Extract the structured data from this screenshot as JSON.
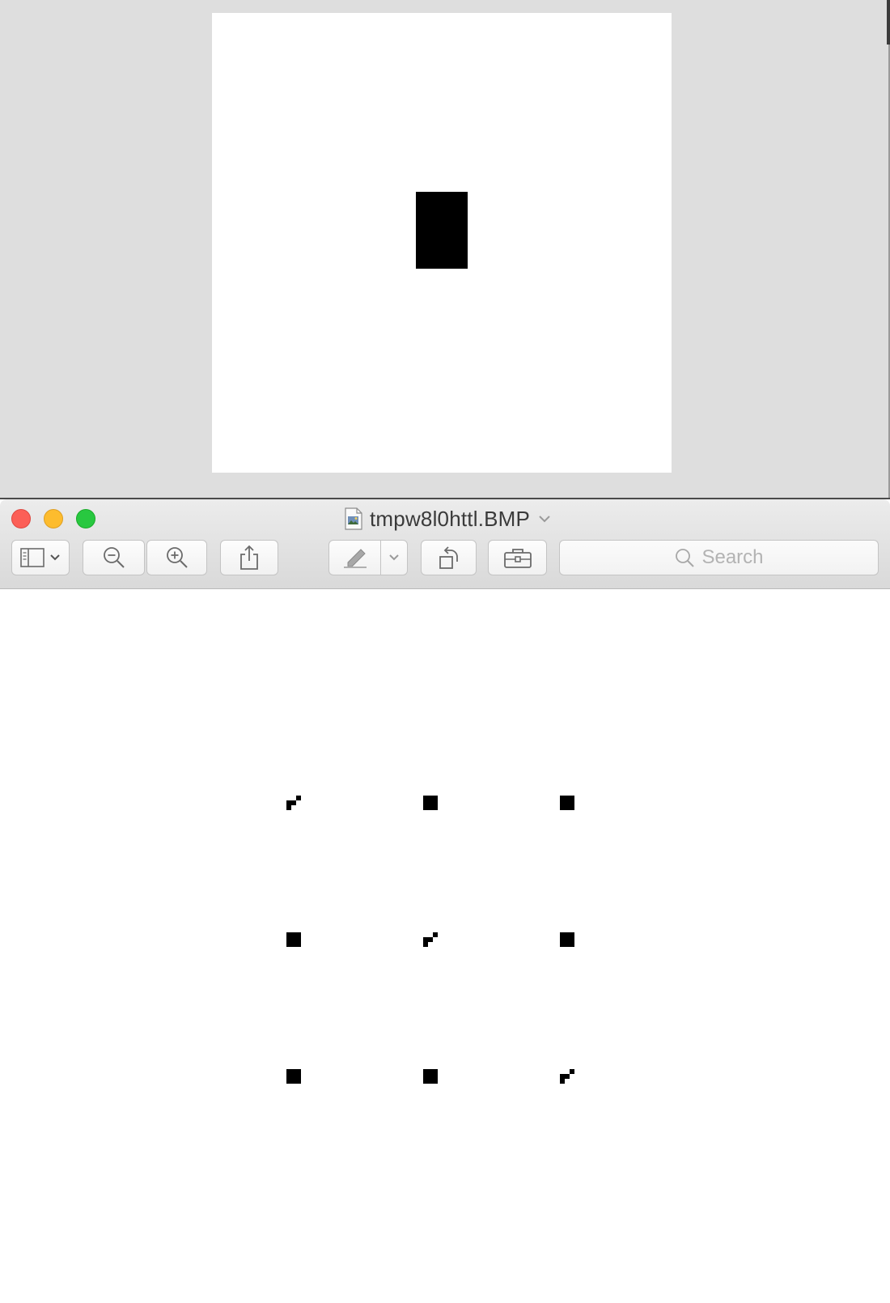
{
  "window": {
    "title": "tmpw8l0httl.BMP",
    "document_icon": "image-document-icon",
    "title_menu_icon": "chevron-down-icon"
  },
  "toolbar": {
    "sidebar_button_icon": "sidebar-icon",
    "sidebar_menu_icon": "chevron-down-icon",
    "zoom_out_icon": "zoom-out-icon",
    "zoom_in_icon": "zoom-in-icon",
    "share_icon": "share-icon",
    "markup_icon": "pen-markup-icon",
    "markup_menu_icon": "chevron-down-icon",
    "rotate_icon": "rotate-left-icon",
    "toolbox_icon": "toolbox-icon"
  },
  "search": {
    "placeholder": "Search",
    "icon": "search-icon"
  },
  "colors": {
    "close": "#fc5f57",
    "minimize": "#fdbc2e",
    "maximize": "#28c840",
    "pixel": "#000000",
    "canvas": "#ffffff",
    "window_background": "#dedede"
  },
  "image": {
    "grid": [
      [
        "checker",
        "solid",
        "solid"
      ],
      [
        "solid",
        "checker",
        "solid"
      ],
      [
        "solid",
        "solid",
        "checker"
      ]
    ]
  }
}
